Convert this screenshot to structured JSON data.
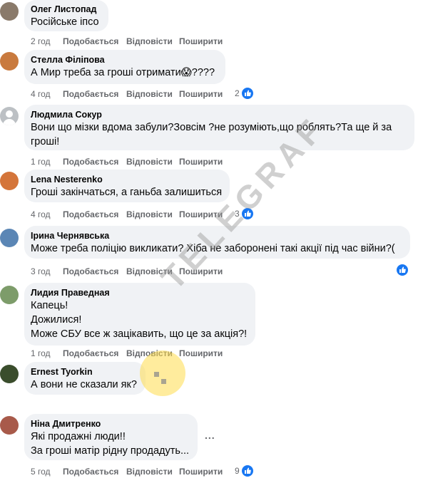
{
  "actions": {
    "like_label": "Подобається",
    "reply_label": "Відповісти",
    "share_label": "Поширити"
  },
  "watermark": "TELEGRAF",
  "comments": [
    {
      "author": "Олег Листопад",
      "lines": [
        "Російське іпсо"
      ],
      "time": "2 год",
      "reactions": null
    },
    {
      "author": "Стелла Філіпова",
      "lines": [
        "А Мир треба за гроші отримати😱????"
      ],
      "time": "4 год",
      "reactions": "2"
    },
    {
      "author": "Людмила Сокур",
      "lines": [
        "Вони що мізки вдома забули?Зовсім ?не розуміють,що роблять?Та ще й за",
        "гроші!"
      ],
      "time": "1 год",
      "reactions": null
    },
    {
      "author": "Lena Nesterenko",
      "lines": [
        "Гроші закінчаться, а ганьба залишиться"
      ],
      "time": "4 год",
      "reactions": "3"
    },
    {
      "author": "Ірина Чернявська",
      "lines": [
        "Може треба поліцію викликати? Хіба не заборонені такі акції під час війни?("
      ],
      "time": "3 год",
      "reactions": ""
    },
    {
      "author": "Лидия Праведная",
      "lines": [
        "Капець!",
        "Дожилися!",
        "Може СБУ все ж зацікавить, що це за акція?!"
      ],
      "time": "1 год",
      "reactions": null
    },
    {
      "author": "Ernest Tyorkin",
      "lines": [
        "А вони не сказали як?"
      ],
      "time": "",
      "reactions": null
    },
    {
      "author": "Ніна Дмитренко",
      "lines": [
        "Які продажні люди!!",
        "За гроші матір рідну продадуть..."
      ],
      "time": "5 год",
      "reactions": "9"
    }
  ],
  "more_label": "...",
  "colors": {
    "bubble": "#f0f2f5",
    "meta": "#65676b",
    "like": "#1877f2"
  }
}
